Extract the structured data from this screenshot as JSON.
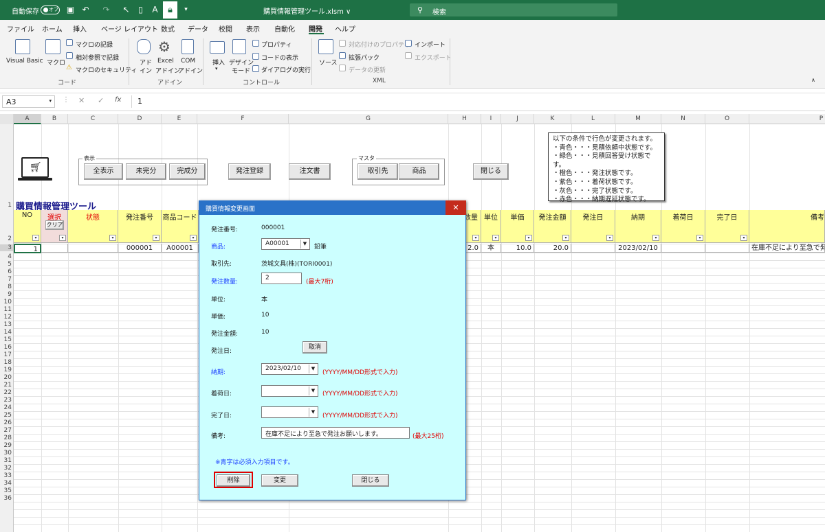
{
  "titlebar": {
    "autosave_label": "自動保存",
    "autosave_state": "オフ",
    "filename": "購買情報管理ツール.xlsm ∨",
    "search_placeholder": "検索"
  },
  "menu": [
    "ファイル",
    "ホーム",
    "挿入",
    "ページ レイアウト",
    "数式",
    "データ",
    "校閲",
    "表示",
    "自動化",
    "開発",
    "ヘルプ"
  ],
  "ribbon": {
    "vb": "Visual Basic",
    "macro": "マクロ",
    "record_macro": "マクロの記録",
    "relative_ref": "相対参照で記録",
    "macro_security": "マクロのセキュリティ",
    "group_code": "コード",
    "addin1": "アド",
    "addin1b": "イン",
    "addin2": "Excel",
    "addin2b": "アドイン",
    "addin3": "COM",
    "addin3b": "アドイン",
    "group_addin": "アドイン",
    "insert": "挿入",
    "design1": "デザイン",
    "design2": "モード",
    "properties": "プロパティ",
    "view_code": "コードの表示",
    "run_dialog": "ダイアログの実行",
    "group_control": "コントロール",
    "source": "ソース",
    "map_props": "対応付けのプロパティ",
    "expansion": "拡張パック",
    "refresh": "データの更新",
    "import": "インポート",
    "export": "エクスポート",
    "group_xml": "XML"
  },
  "formula": {
    "cell_ref": "A3",
    "value": "1",
    "x": "✕",
    "check": "✓",
    "fx": "fx"
  },
  "columns": [
    "A",
    "B",
    "C",
    "D",
    "E",
    "F",
    "G",
    "H",
    "I",
    "J",
    "K",
    "L",
    "M",
    "N",
    "O",
    "P"
  ],
  "rows": [
    "1",
    "2",
    "3",
    "4",
    "5",
    "6",
    "7",
    "8",
    "9",
    "10",
    "11",
    "12",
    "13",
    "14",
    "15",
    "16",
    "17",
    "18",
    "19",
    "20",
    "21",
    "22",
    "23",
    "24",
    "25",
    "26",
    "27",
    "28",
    "29",
    "30",
    "31",
    "32",
    "33",
    "34",
    "35",
    "36"
  ],
  "sheet": {
    "title": "購買情報管理ツール",
    "group_display": "表示",
    "btn_all": "全表示",
    "btn_incomplete": "未完分",
    "btn_complete": "完成分",
    "btn_order": "発注登録",
    "btn_purchase": "注文書",
    "group_master": "マスタ",
    "btn_supplier": "取引先",
    "btn_product": "商品",
    "btn_close": "閉じる",
    "note": [
      "以下の条件で行色が変更されます。",
      "・青色・・・見積依頼中状態です。",
      "・緑色・・・見積回答受け状態です。",
      "・橙色・・・発注状態です。",
      "・紫色・・・着荷状態です。",
      "・灰色・・・完了状態です。",
      "・赤色・・・納期遅延状態です。"
    ],
    "headers": {
      "no": "NO",
      "select": "選択",
      "clear": "クリア",
      "status": "状態",
      "order_no": "発注番号",
      "product_code": "商品コード",
      "qty": "数量",
      "unit": "単位",
      "price": "単価",
      "amount": "発注金額",
      "order_date": "発注日",
      "due": "納期",
      "arrival": "着荷日",
      "done": "完了日",
      "remarks": "備考"
    },
    "row3": {
      "no": "1",
      "order_no": "000001",
      "product_code": "A00001",
      "qty": "2.0",
      "unit": "本",
      "price": "10.0",
      "amount": "20.0",
      "due": "2023/02/10",
      "remarks": "在庫不足により至急で発注"
    }
  },
  "dialog": {
    "title": "購買情報変更画面",
    "close": "✕",
    "order_no_label": "発注番号:",
    "order_no": "000001",
    "product_label": "商品:",
    "product_code": "A00001",
    "product_name": "鉛筆",
    "supplier_label": "取引先:",
    "supplier": "茨城文具(株)(TORI0001)",
    "qty_label": "発注数量:",
    "qty": "2",
    "qty_hint": "(最大7桁)",
    "unit_label": "単位:",
    "unit": "本",
    "price_label": "単価:",
    "price": "10",
    "amount_label": "発注金額:",
    "amount": "10",
    "order_date_label": "発注日:",
    "cancel": "取消",
    "due_label": "納期:",
    "due": "2023/02/10",
    "date_hint": "(YYYY/MM/DD形式で入力)",
    "arrival_label": "着荷日:",
    "done_label": "完了日:",
    "remarks_label": "備考:",
    "remarks": "在庫不足により至急で発注お願いします。",
    "remarks_hint": "(最大25桁)",
    "required_note": "※青字は必須入力項目です。",
    "btn_delete": "削除",
    "btn_change": "変更",
    "btn_close": "閉じる"
  },
  "colors": {
    "excel_green": "#1e7145",
    "header_yellow": "#ffff99",
    "header_pink": "#f2dcdb",
    "dialog_bg": "#ccffff",
    "dialog_title": "#2a72c8",
    "required_blue": "#1a3cff",
    "hint_red": "#e00000",
    "highlight_red": "#e00000"
  }
}
